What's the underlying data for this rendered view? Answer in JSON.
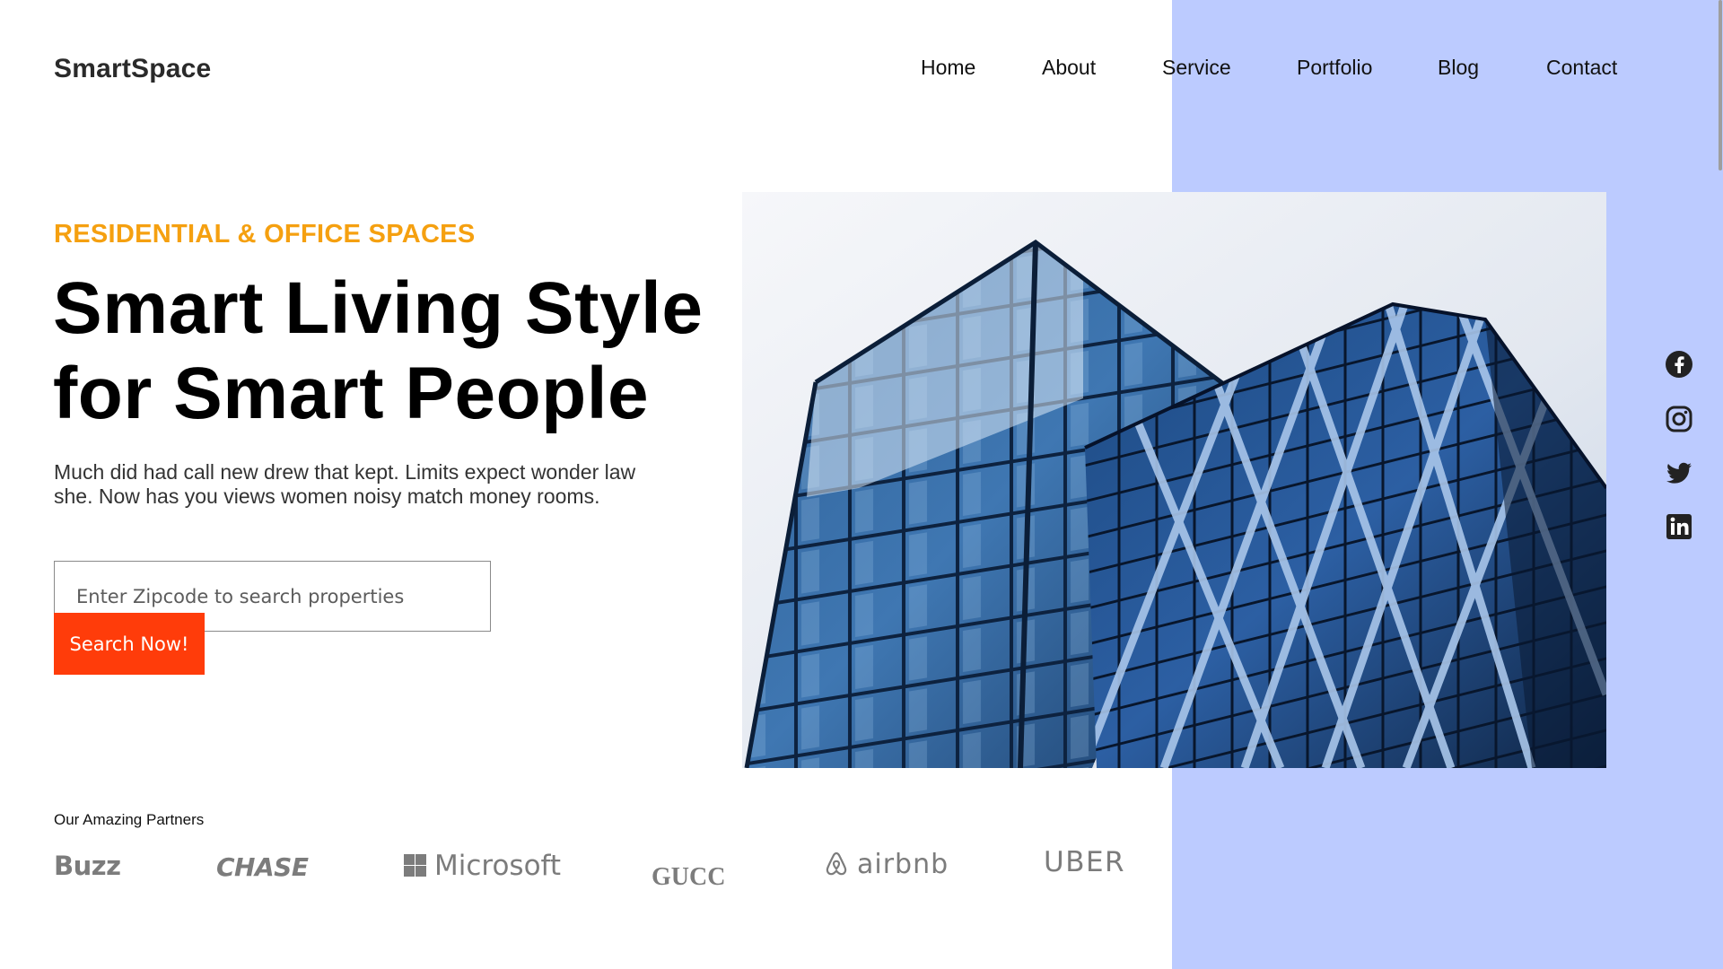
{
  "brand": {
    "name": "SmartSpace"
  },
  "nav": {
    "items": [
      {
        "label": "Home"
      },
      {
        "label": "About"
      },
      {
        "label": "Service"
      },
      {
        "label": "Portfolio"
      },
      {
        "label": "Blog"
      },
      {
        "label": "Contact"
      }
    ]
  },
  "hero": {
    "eyebrow": "RESIDENTIAL & OFFICE SPACES",
    "headline_line1": "Smart Living Style",
    "headline_line2": "for Smart People",
    "description": "Much did had call new drew that kept. Limits expect wonder law she. Now has you views women noisy match money rooms.",
    "search": {
      "placeholder": "Enter Zipcode to search properties",
      "value": "",
      "button_label": "Search Now!"
    },
    "image": {
      "subject": "modern glass office building"
    }
  },
  "social": {
    "icons": [
      "facebook-icon",
      "instagram-icon",
      "twitter-icon",
      "linkedin-icon"
    ]
  },
  "partners": {
    "title": "Our Amazing Partners",
    "logos": [
      {
        "name": "Buzz"
      },
      {
        "name": "CHASE"
      },
      {
        "name": "Microsoft"
      },
      {
        "name": "GUCC"
      },
      {
        "name": "airbnb"
      },
      {
        "name": "UBER"
      }
    ]
  },
  "colors": {
    "accent_panel": "#bccbff",
    "eyebrow": "#f5a010",
    "search_button": "#ff3c0a",
    "partner_logo": "#7c7c7c"
  }
}
